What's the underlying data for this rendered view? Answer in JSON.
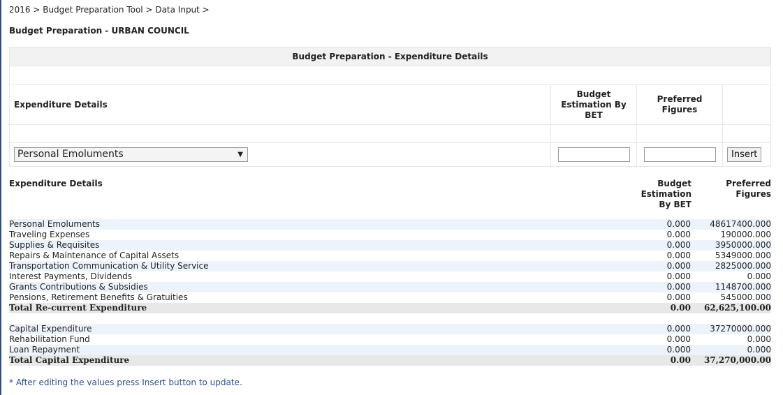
{
  "breadcrumb": "2016 > Budget Preparation Tool > Data Input >",
  "page_title": "Budget Preparation - URBAN COUNCIL",
  "form": {
    "title": "Budget Preparation - Expenditure Details",
    "col_label": "Expenditure Details",
    "col_bet": "Budget Estimation By BET",
    "col_pref": "Preferred Figures",
    "selected_category": "Personal Emoluments",
    "bet_value": "",
    "pref_value": "",
    "insert_label": "Insert"
  },
  "summary": {
    "col_label": "Expenditure Details",
    "col_bet": "Budget Estimation By BET",
    "col_pref": "Preferred Figures",
    "recurrent": [
      {
        "label": "Personal Emoluments",
        "bet": "0.000",
        "pref": "48617400.000"
      },
      {
        "label": "Traveling Expenses",
        "bet": "0.000",
        "pref": "190000.000"
      },
      {
        "label": "Supplies & Requisites",
        "bet": "0.000",
        "pref": "3950000.000"
      },
      {
        "label": "Repairs & Maintenance of Capital Assets",
        "bet": "0.000",
        "pref": "5349000.000"
      },
      {
        "label": "Transportation Communication & Utility Service",
        "bet": "0.000",
        "pref": "2825000.000"
      },
      {
        "label": "Interest Payments, Dividends",
        "bet": "0.000",
        "pref": "0.000"
      },
      {
        "label": "Grants Contributions & Subsidies",
        "bet": "0.000",
        "pref": "1148700.000"
      },
      {
        "label": "Pensions, Retirement Benefits & Gratuities",
        "bet": "0.000",
        "pref": "545000.000"
      }
    ],
    "recurrent_total": {
      "label": "Total Re-current Expenditure",
      "bet": "0.00",
      "pref": "62,625,100.00"
    },
    "capital": [
      {
        "label": "Capital Expenditure",
        "bet": "0.000",
        "pref": "37270000.000"
      },
      {
        "label": "Rehabilitation Fund",
        "bet": "0.000",
        "pref": "0.000"
      },
      {
        "label": "Loan Repayment",
        "bet": "0.000",
        "pref": "0.000"
      }
    ],
    "capital_total": {
      "label": "Total Capital Expenditure",
      "bet": "0.00",
      "pref": "37,270,000.00"
    }
  },
  "note": "* After editing the values press Insert button to update."
}
